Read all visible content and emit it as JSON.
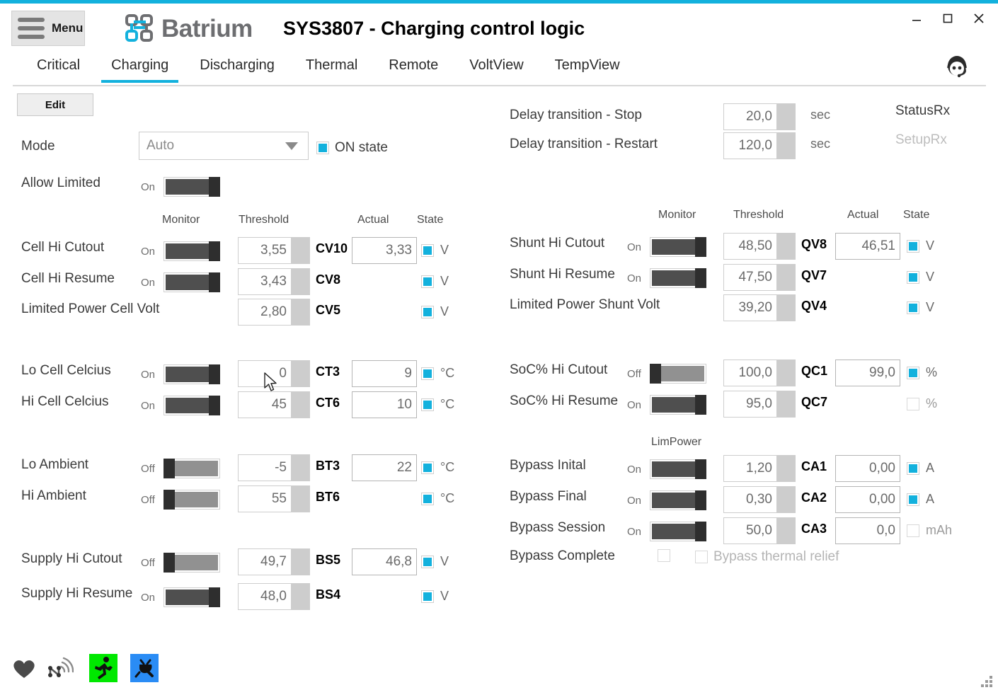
{
  "window": {
    "accent_color": "#13b1dd",
    "menu_label": "Menu",
    "brand": "Batrium",
    "title": "SYS3807 - Charging control logic",
    "minimize": "–",
    "maximize": "☐",
    "close": "✕",
    "avatar_name": "support-agent-avatar"
  },
  "tabs": {
    "active": "Charging",
    "items": [
      {
        "label": "Critical"
      },
      {
        "label": "Charging"
      },
      {
        "label": "Discharging"
      },
      {
        "label": "Thermal"
      },
      {
        "label": "Remote"
      },
      {
        "label": "VoltView"
      },
      {
        "label": "TempView"
      }
    ]
  },
  "toolbar": {
    "edit_label": "Edit"
  },
  "mode": {
    "label": "Mode",
    "value": "Auto",
    "on_state_label": "ON state",
    "on_state_checked": true
  },
  "allow_limited": {
    "label": "Allow Limited",
    "monitor_state": "On"
  },
  "left_headers": {
    "monitor": "Monitor",
    "threshold": "Threshold",
    "actual": "Actual",
    "state": "State"
  },
  "right_headers": {
    "monitor": "Monitor",
    "threshold": "Threshold",
    "actual": "Actual",
    "state": "State",
    "limpower": "LimPower"
  },
  "delays": {
    "stop_label": "Delay transition - Stop",
    "stop_value": "20,0",
    "stop_unit": "sec",
    "restart_label": "Delay transition - Restart",
    "restart_value": "120,0",
    "restart_unit": "sec",
    "status_rx": "StatusRx",
    "setup_rx": "SetupRx"
  },
  "left_rows": [
    {
      "label": "Cell Hi Cutout",
      "monitor": "On",
      "toggle": "on",
      "threshold": "3,55",
      "code": "CV10",
      "actual": "3,33",
      "has_actual": true,
      "state": true,
      "unit": "V"
    },
    {
      "label": "Cell Hi Resume",
      "monitor": "On",
      "toggle": "on",
      "threshold": "3,43",
      "code": "CV8",
      "actual": "",
      "has_actual": false,
      "state": true,
      "unit": "V"
    },
    {
      "label": "Limited Power Cell Volt",
      "monitor": "",
      "toggle": "none",
      "threshold": "2,80",
      "code": "CV5",
      "actual": "",
      "has_actual": false,
      "state": true,
      "unit": "V"
    },
    {
      "label": "Lo Cell Celcius",
      "monitor": "On",
      "toggle": "on",
      "threshold": "0",
      "code": "CT3",
      "actual": "9",
      "has_actual": true,
      "state": true,
      "unit": "°C"
    },
    {
      "label": "Hi Cell Celcius",
      "monitor": "On",
      "toggle": "on",
      "threshold": "45",
      "code": "CT6",
      "actual": "10",
      "has_actual": true,
      "state": true,
      "unit": "°C"
    },
    {
      "label": "Lo Ambient",
      "monitor": "Off",
      "toggle": "off",
      "threshold": "-5",
      "code": "BT3",
      "actual": "22",
      "has_actual": true,
      "state": true,
      "unit": "°C"
    },
    {
      "label": "Hi Ambient",
      "monitor": "Off",
      "toggle": "off",
      "threshold": "55",
      "code": "BT6",
      "actual": "",
      "has_actual": false,
      "state": true,
      "unit": "°C"
    },
    {
      "label": "Supply Hi Cutout",
      "monitor": "Off",
      "toggle": "off",
      "threshold": "49,7",
      "code": "BS5",
      "actual": "46,8",
      "has_actual": true,
      "state": true,
      "unit": "V"
    },
    {
      "label": "Supply Hi Resume",
      "monitor": "On",
      "toggle": "on",
      "threshold": "48,0",
      "code": "BS4",
      "actual": "",
      "has_actual": false,
      "state": true,
      "unit": "V"
    }
  ],
  "right_rows": [
    {
      "label": "Shunt Hi Cutout",
      "monitor": "On",
      "toggle": "on",
      "threshold": "48,50",
      "code": "QV8",
      "actual": "46,51",
      "has_actual": true,
      "state": true,
      "unit": "V"
    },
    {
      "label": "Shunt Hi Resume",
      "monitor": "On",
      "toggle": "on",
      "threshold": "47,50",
      "code": "QV7",
      "actual": "",
      "has_actual": false,
      "state": true,
      "unit": "V"
    },
    {
      "label": "Limited Power Shunt Volt",
      "monitor": "",
      "toggle": "none",
      "threshold": "39,20",
      "code": "QV4",
      "actual": "",
      "has_actual": false,
      "state": true,
      "unit": "V"
    },
    {
      "label": "SoC% Hi Cutout",
      "monitor": "Off",
      "toggle": "off",
      "threshold": "100,0",
      "code": "QC1",
      "actual": "99,0",
      "has_actual": true,
      "state": true,
      "unit": "%"
    },
    {
      "label": "SoC% Hi Resume",
      "monitor": "On",
      "toggle": "on",
      "threshold": "95,0",
      "code": "QC7",
      "actual": "",
      "has_actual": false,
      "state": false,
      "unit": "%"
    },
    {
      "label": "Bypass Inital",
      "monitor": "On",
      "toggle": "on",
      "threshold": "1,20",
      "code": "CA1",
      "actual": "0,00",
      "has_actual": true,
      "state": true,
      "unit": "A"
    },
    {
      "label": "Bypass Final",
      "monitor": "On",
      "toggle": "on",
      "threshold": "0,30",
      "code": "CA2",
      "actual": "0,00",
      "has_actual": true,
      "state": true,
      "unit": "A"
    },
    {
      "label": "Bypass Session",
      "monitor": "On",
      "toggle": "on",
      "threshold": "50,0",
      "code": "CA3",
      "actual": "0,0",
      "has_actual": true,
      "state": false,
      "unit": "mAh"
    }
  ],
  "bypass_complete": {
    "label": "Bypass Complete",
    "checked": false,
    "thermal_relief_label": "Bypass thermal relief",
    "thermal_relief_checked": false
  },
  "status_icons": [
    {
      "name": "heart-icon",
      "color": "#4a4a4a",
      "bg": "none"
    },
    {
      "name": "network-icon",
      "color": "#6b6b6b",
      "bg": "none"
    },
    {
      "name": "running-man-icon",
      "color": "#1a1a1a",
      "bg": "#00e800"
    },
    {
      "name": "power-plug-icon",
      "color": "#1a1a1a",
      "bg": "#2a8cf5"
    }
  ]
}
